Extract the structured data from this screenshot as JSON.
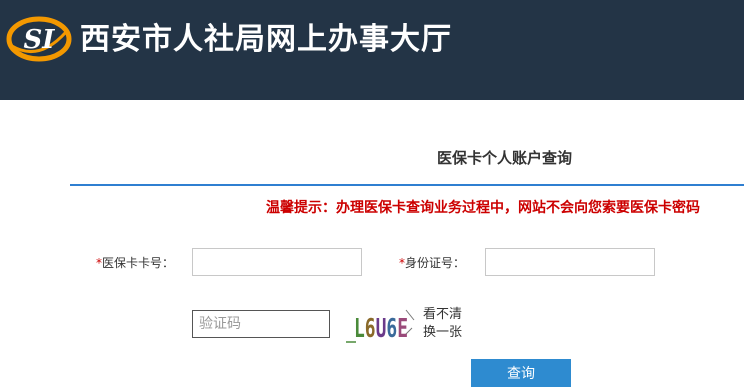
{
  "header": {
    "logo_text": "SI",
    "title": "西安市人社局网上办事大厅"
  },
  "main": {
    "heading": "医保卡个人账户查询",
    "notice": "温馨提示：办理医保卡查询业务过程中，网站不会向您索要医保卡密码",
    "form": {
      "card_label_required": "*",
      "card_label": "医保卡卡号：",
      "card_value": "",
      "id_label_required": "*",
      "id_label": "身份证号：",
      "id_value": "",
      "captcha_placeholder": "验证码",
      "captcha_text": "L6U6E",
      "refresh_line1": "看不清",
      "refresh_line2": "换一张",
      "submit_label": "查询"
    }
  },
  "colors": {
    "header_bg": "#233446",
    "divider": "#2f7fd1",
    "notice": "#cc0000",
    "button": "#2e8bd0",
    "logo_orange": "#f39800"
  }
}
